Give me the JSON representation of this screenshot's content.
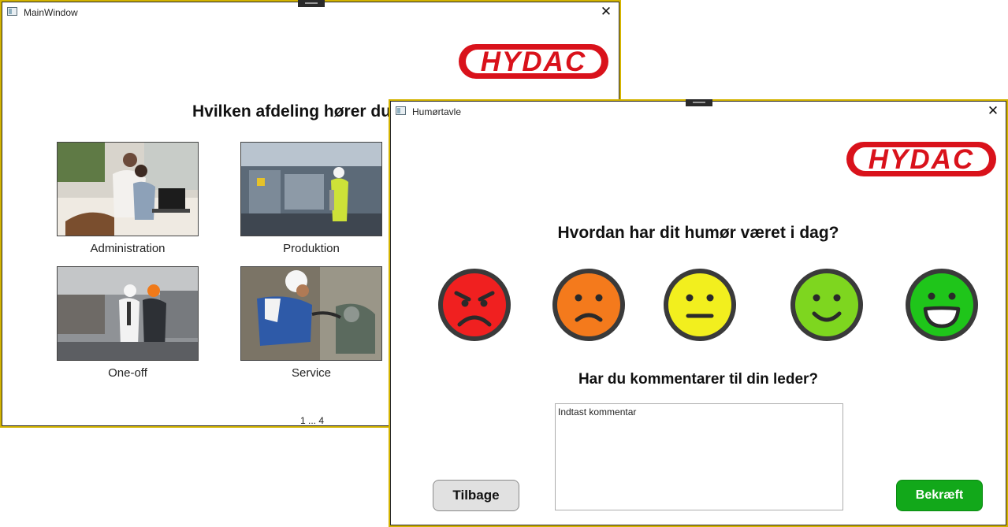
{
  "main_window": {
    "title": "MainWindow",
    "logo": "HYDAC",
    "question": "Hvilken afdeling hører du til?",
    "departments": [
      {
        "label": "Administration"
      },
      {
        "label": "Produktion"
      },
      {
        "label": "One-off"
      },
      {
        "label": "Service"
      }
    ],
    "pager": "1 ... 4"
  },
  "mood_window": {
    "title": "Humørtavle",
    "logo": "HYDAC",
    "mood_question": "Hvordan har dit humør været i dag?",
    "moods": [
      {
        "name": "angry",
        "color": "#f02020"
      },
      {
        "name": "sad",
        "color": "#f47a1c"
      },
      {
        "name": "neutral",
        "color": "#f2ef1e"
      },
      {
        "name": "happy",
        "color": "#7ed61f"
      },
      {
        "name": "very-happy",
        "color": "#1fc51a"
      }
    ],
    "comment_question": "Har du kommentarer til din leder?",
    "comment_placeholder": "Indtast kommentar",
    "back_label": "Tilbage",
    "confirm_label": "Bekræft"
  },
  "colors": {
    "brand_red": "#d9121b",
    "window_border": "#d4b400",
    "confirm_green": "#12a81a"
  }
}
